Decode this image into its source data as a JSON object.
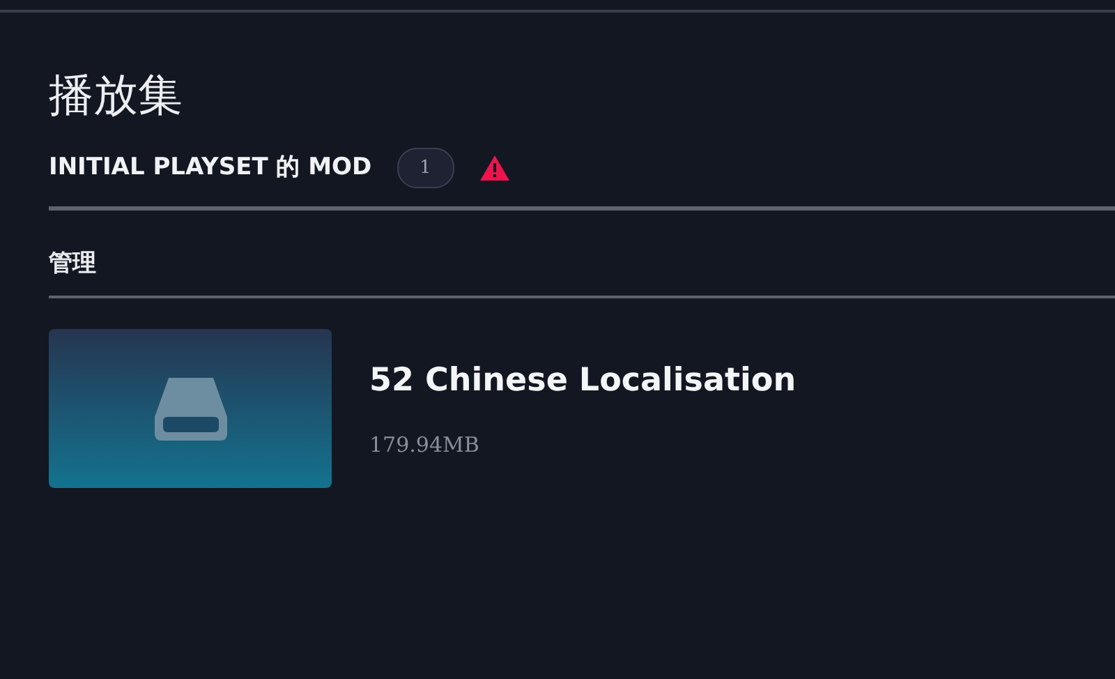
{
  "title": "播放集",
  "playset": {
    "heading": "INITIAL PLAYSET 的 MOD",
    "count": "1",
    "warning": true
  },
  "manage": {
    "heading": "管理"
  },
  "mods": [
    {
      "name": "52 Chinese Localisation",
      "size": "179.94MB"
    }
  ]
}
